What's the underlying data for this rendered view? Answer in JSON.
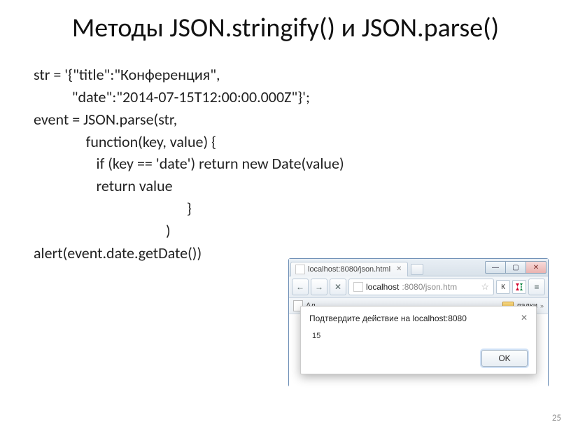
{
  "title": "Методы JSON.stringify() и JSON.parse()",
  "code": {
    "l1": "str = '{\"title\":\"Конференция\",",
    "l2": "           \"date\":\"2014-07-15T12:00:00.000Z\"}';",
    "l3": "event = JSON.parse(str,",
    "l4": "               function(key, value) {",
    "l5": "                  if (key == 'date') return new Date(value)",
    "l6": "                  return value",
    "l7": "                                            }",
    "l8": "                                      )",
    "l9": "alert(event.date.getDate())"
  },
  "browser": {
    "tab_label": "localhost:8080/json.html",
    "url_host": "localhost",
    "url_rest": ":8080/json.htm",
    "ext_label": "К",
    "bookmark_label": "Ал",
    "bookmark_right": "ладки"
  },
  "alert": {
    "header": "Подтвердите действие на localhost:8080",
    "body": "15",
    "ok": "OK"
  },
  "slide_number": "25"
}
